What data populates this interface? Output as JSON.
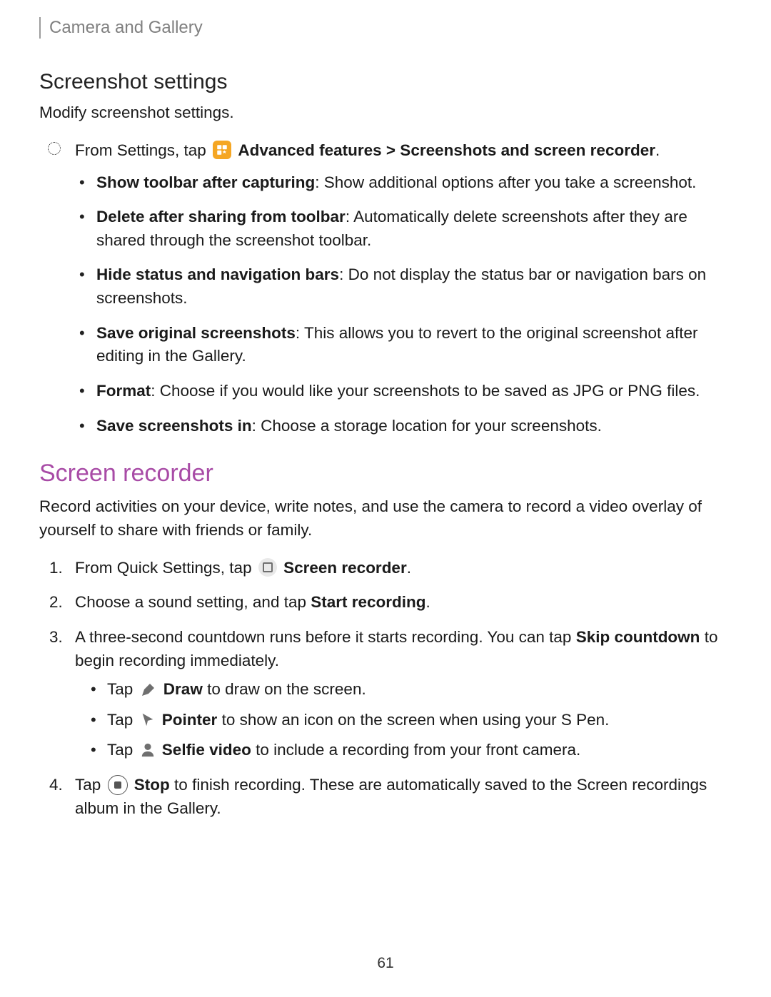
{
  "breadcrumb": "Camera and Gallery",
  "section1": {
    "title": "Screenshot settings",
    "intro": "Modify screenshot settings.",
    "nav_prefix": "From Settings, tap ",
    "nav_bold": "Advanced features > Screenshots and screen recorder",
    "nav_suffix": ".",
    "options": [
      {
        "label": "Show toolbar after capturing",
        "desc": ": Show additional options after you take a screenshot."
      },
      {
        "label": "Delete after sharing from toolbar",
        "desc": ": Automatically delete screenshots after they are shared through the screenshot toolbar."
      },
      {
        "label": "Hide status and navigation bars",
        "desc": ": Do not display the status bar or navigation bars on screenshots."
      },
      {
        "label": "Save original screenshots",
        "desc": ": This allows you to revert to the original screenshot after editing in the Gallery."
      },
      {
        "label": "Format",
        "desc": ": Choose if you would like your screenshots to be saved as JPG or PNG files."
      },
      {
        "label": "Save screenshots in",
        "desc": ": Choose a storage location for your screenshots."
      }
    ]
  },
  "section2": {
    "title": "Screen recorder",
    "intro": "Record activities on your device, write notes, and use the camera to record a video overlay of yourself to share with friends or family.",
    "steps": {
      "s1": {
        "num": "1.",
        "prefix": "From Quick Settings, tap ",
        "bold": "Screen recorder",
        "suffix": "."
      },
      "s2": {
        "num": "2.",
        "prefix": "Choose a sound setting, and tap ",
        "bold": "Start recording",
        "suffix": "."
      },
      "s3": {
        "num": "3.",
        "line_a": "A three-second countdown runs before it starts recording. You can tap ",
        "skip": "Skip countdown",
        "line_b": " to begin recording immediately.",
        "sub": [
          {
            "pre": "Tap ",
            "label": "Draw",
            "post": " to draw on the screen."
          },
          {
            "pre": "Tap ",
            "label": "Pointer",
            "post": " to show an icon on the screen when using your S Pen."
          },
          {
            "pre": "Tap ",
            "label": "Selfie video",
            "post": " to include a recording from your front camera."
          }
        ]
      },
      "s4": {
        "num": "4.",
        "pre": "Tap ",
        "label": "Stop",
        "post": " to finish recording. These are automatically saved to the Screen recordings album in the Gallery."
      }
    }
  },
  "page_number": "61"
}
